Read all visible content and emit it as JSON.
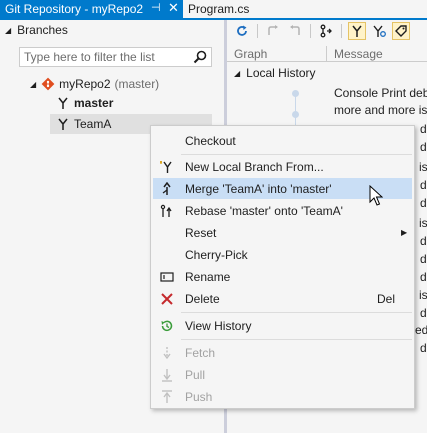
{
  "tabs": {
    "active_title": "Git Repository - myRepo2",
    "pin_glyph": "⊣",
    "close_glyph": "✕",
    "inactive_title": "Program.cs"
  },
  "branches": {
    "header": "Branches",
    "filter_placeholder": "Type here to filter the list",
    "repo_name": "myRepo2",
    "repo_branch": "(master)",
    "items": [
      "master",
      "TeamA"
    ]
  },
  "history": {
    "col_graph": "Graph",
    "col_message": "Message",
    "section": "Local History",
    "messages": [
      "Console Print deb",
      "more and more is",
      "d",
      "d",
      "is",
      "d",
      "d",
      "is",
      "d",
      "d",
      "d",
      "is",
      "d",
      "ed,",
      "d"
    ]
  },
  "context_menu": {
    "items": [
      {
        "label": "Checkout",
        "icon": "",
        "shortcut": "",
        "submenu": false,
        "enabled": true
      },
      {
        "label": "New Local Branch From...",
        "icon": "new-branch-icon",
        "shortcut": "",
        "submenu": false,
        "enabled": true
      },
      {
        "label": "Merge 'TeamA' into 'master'",
        "icon": "merge-icon",
        "shortcut": "",
        "submenu": false,
        "enabled": true,
        "highlighted": true
      },
      {
        "label": "Rebase 'master' onto 'TeamA'",
        "icon": "rebase-icon",
        "shortcut": "",
        "submenu": false,
        "enabled": true
      },
      {
        "label": "Reset",
        "icon": "",
        "shortcut": "",
        "submenu": true,
        "enabled": true
      },
      {
        "label": "Cherry-Pick",
        "icon": "",
        "shortcut": "",
        "submenu": false,
        "enabled": true
      },
      {
        "label": "Rename",
        "icon": "rename-icon",
        "shortcut": "",
        "submenu": false,
        "enabled": true
      },
      {
        "label": "Delete",
        "icon": "delete-icon",
        "shortcut": "Del",
        "submenu": false,
        "enabled": true
      },
      {
        "label": "View History",
        "icon": "history-icon",
        "shortcut": "",
        "submenu": false,
        "enabled": true
      },
      {
        "label": "Fetch",
        "icon": "fetch-icon",
        "shortcut": "",
        "submenu": false,
        "enabled": false
      },
      {
        "label": "Pull",
        "icon": "pull-icon",
        "shortcut": "",
        "submenu": false,
        "enabled": false
      },
      {
        "label": "Push",
        "icon": "push-icon",
        "shortcut": "",
        "submenu": false,
        "enabled": false
      }
    ]
  },
  "colors": {
    "accent": "#007acc",
    "menu_highlight": "#c9def5",
    "repo_icon": "#e04e1f",
    "delete_red": "#c5292d",
    "history_green": "#3a9c3a",
    "disabled_text": "#a2a2a2"
  }
}
